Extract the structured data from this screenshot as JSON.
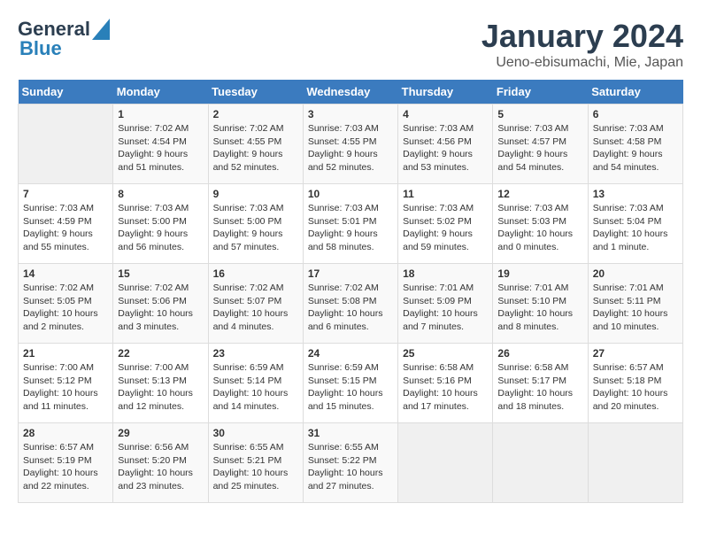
{
  "header": {
    "logo_general": "General",
    "logo_blue": "Blue",
    "month_title": "January 2024",
    "location": "Ueno-ebisumachi, Mie, Japan"
  },
  "calendar": {
    "days_of_week": [
      "Sunday",
      "Monday",
      "Tuesday",
      "Wednesday",
      "Thursday",
      "Friday",
      "Saturday"
    ],
    "weeks": [
      [
        {
          "day": "",
          "info": ""
        },
        {
          "day": "1",
          "info": "Sunrise: 7:02 AM\nSunset: 4:54 PM\nDaylight: 9 hours\nand 51 minutes."
        },
        {
          "day": "2",
          "info": "Sunrise: 7:02 AM\nSunset: 4:55 PM\nDaylight: 9 hours\nand 52 minutes."
        },
        {
          "day": "3",
          "info": "Sunrise: 7:03 AM\nSunset: 4:55 PM\nDaylight: 9 hours\nand 52 minutes."
        },
        {
          "day": "4",
          "info": "Sunrise: 7:03 AM\nSunset: 4:56 PM\nDaylight: 9 hours\nand 53 minutes."
        },
        {
          "day": "5",
          "info": "Sunrise: 7:03 AM\nSunset: 4:57 PM\nDaylight: 9 hours\nand 54 minutes."
        },
        {
          "day": "6",
          "info": "Sunrise: 7:03 AM\nSunset: 4:58 PM\nDaylight: 9 hours\nand 54 minutes."
        }
      ],
      [
        {
          "day": "7",
          "info": "Sunrise: 7:03 AM\nSunset: 4:59 PM\nDaylight: 9 hours\nand 55 minutes."
        },
        {
          "day": "8",
          "info": "Sunrise: 7:03 AM\nSunset: 5:00 PM\nDaylight: 9 hours\nand 56 minutes."
        },
        {
          "day": "9",
          "info": "Sunrise: 7:03 AM\nSunset: 5:00 PM\nDaylight: 9 hours\nand 57 minutes."
        },
        {
          "day": "10",
          "info": "Sunrise: 7:03 AM\nSunset: 5:01 PM\nDaylight: 9 hours\nand 58 minutes."
        },
        {
          "day": "11",
          "info": "Sunrise: 7:03 AM\nSunset: 5:02 PM\nDaylight: 9 hours\nand 59 minutes."
        },
        {
          "day": "12",
          "info": "Sunrise: 7:03 AM\nSunset: 5:03 PM\nDaylight: 10 hours\nand 0 minutes."
        },
        {
          "day": "13",
          "info": "Sunrise: 7:03 AM\nSunset: 5:04 PM\nDaylight: 10 hours\nand 1 minute."
        }
      ],
      [
        {
          "day": "14",
          "info": "Sunrise: 7:02 AM\nSunset: 5:05 PM\nDaylight: 10 hours\nand 2 minutes."
        },
        {
          "day": "15",
          "info": "Sunrise: 7:02 AM\nSunset: 5:06 PM\nDaylight: 10 hours\nand 3 minutes."
        },
        {
          "day": "16",
          "info": "Sunrise: 7:02 AM\nSunset: 5:07 PM\nDaylight: 10 hours\nand 4 minutes."
        },
        {
          "day": "17",
          "info": "Sunrise: 7:02 AM\nSunset: 5:08 PM\nDaylight: 10 hours\nand 6 minutes."
        },
        {
          "day": "18",
          "info": "Sunrise: 7:01 AM\nSunset: 5:09 PM\nDaylight: 10 hours\nand 7 minutes."
        },
        {
          "day": "19",
          "info": "Sunrise: 7:01 AM\nSunset: 5:10 PM\nDaylight: 10 hours\nand 8 minutes."
        },
        {
          "day": "20",
          "info": "Sunrise: 7:01 AM\nSunset: 5:11 PM\nDaylight: 10 hours\nand 10 minutes."
        }
      ],
      [
        {
          "day": "21",
          "info": "Sunrise: 7:00 AM\nSunset: 5:12 PM\nDaylight: 10 hours\nand 11 minutes."
        },
        {
          "day": "22",
          "info": "Sunrise: 7:00 AM\nSunset: 5:13 PM\nDaylight: 10 hours\nand 12 minutes."
        },
        {
          "day": "23",
          "info": "Sunrise: 6:59 AM\nSunset: 5:14 PM\nDaylight: 10 hours\nand 14 minutes."
        },
        {
          "day": "24",
          "info": "Sunrise: 6:59 AM\nSunset: 5:15 PM\nDaylight: 10 hours\nand 15 minutes."
        },
        {
          "day": "25",
          "info": "Sunrise: 6:58 AM\nSunset: 5:16 PM\nDaylight: 10 hours\nand 17 minutes."
        },
        {
          "day": "26",
          "info": "Sunrise: 6:58 AM\nSunset: 5:17 PM\nDaylight: 10 hours\nand 18 minutes."
        },
        {
          "day": "27",
          "info": "Sunrise: 6:57 AM\nSunset: 5:18 PM\nDaylight: 10 hours\nand 20 minutes."
        }
      ],
      [
        {
          "day": "28",
          "info": "Sunrise: 6:57 AM\nSunset: 5:19 PM\nDaylight: 10 hours\nand 22 minutes."
        },
        {
          "day": "29",
          "info": "Sunrise: 6:56 AM\nSunset: 5:20 PM\nDaylight: 10 hours\nand 23 minutes."
        },
        {
          "day": "30",
          "info": "Sunrise: 6:55 AM\nSunset: 5:21 PM\nDaylight: 10 hours\nand 25 minutes."
        },
        {
          "day": "31",
          "info": "Sunrise: 6:55 AM\nSunset: 5:22 PM\nDaylight: 10 hours\nand 27 minutes."
        },
        {
          "day": "",
          "info": ""
        },
        {
          "day": "",
          "info": ""
        },
        {
          "day": "",
          "info": ""
        }
      ]
    ]
  }
}
